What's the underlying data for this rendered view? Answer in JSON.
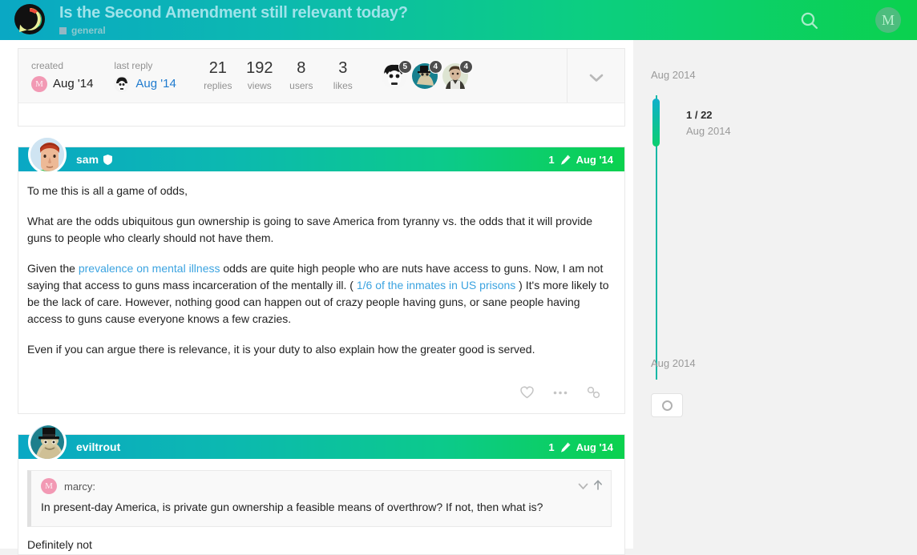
{
  "header": {
    "topic_title": "Is the Second Amendment still relevant today?",
    "category": "general",
    "logo_name": "discourse-logo",
    "search_icon": "search-icon",
    "menu_icon": "hamburger-menu-icon",
    "user_avatar_letter": "M",
    "gradient_start": "#0aa8c4",
    "gradient_end": "#0bd14e",
    "title_color": "#9fe3ea"
  },
  "topic_map": {
    "created_label": "created",
    "created_avatar_letter": "M",
    "created_date": "Aug '14",
    "last_reply_label": "last reply",
    "last_reply_date": "Aug '14",
    "stats": [
      {
        "value": "21",
        "label": "replies"
      },
      {
        "value": "192",
        "label": "views"
      },
      {
        "value": "8",
        "label": "users"
      },
      {
        "value": "3",
        "label": "likes"
      }
    ],
    "participants": [
      {
        "name": "participant-1",
        "count": "5"
      },
      {
        "name": "participant-2",
        "count": "4"
      },
      {
        "name": "participant-3",
        "count": "4"
      }
    ],
    "expand_icon": "chevron-down-icon"
  },
  "posts": [
    {
      "username": "sam",
      "badge_icon": "shield-icon",
      "post_number": "1",
      "edit_icon": "pencil-icon",
      "date": "Aug '14",
      "paragraphs": [
        {
          "parts": [
            {
              "text": "To me this is all a game of odds,"
            }
          ]
        },
        {
          "parts": [
            {
              "text": "What are the odds ubiquitous gun ownership is going to save America from tyranny vs. the odds that it will provide guns to people who clearly should not have them."
            }
          ]
        },
        {
          "parts": [
            {
              "text": "Given the "
            },
            {
              "text": "prevalence on mental illness",
              "link": true
            },
            {
              "text": " odds are quite high people who are nuts have access to guns. Now, I am not saying that access to guns mass incarceration of the mentally ill. ( "
            },
            {
              "text": "1/6 of the inmates in US prisons",
              "link": true
            },
            {
              "text": " ) It's more likely to be the lack of care. However, nothing good can happen out of crazy people having guns, or sane people having access to guns cause everyone knows a few crazies."
            }
          ]
        },
        {
          "parts": [
            {
              "text": "Even if you can argue there is relevance, it is your duty to also explain how the greater good is served."
            }
          ]
        }
      ],
      "actions": [
        {
          "name": "like-button",
          "icon": "heart-icon"
        },
        {
          "name": "show-more-actions-button",
          "icon": "ellipsis-icon"
        },
        {
          "name": "share-button",
          "icon": "link-icon"
        }
      ]
    },
    {
      "username": "eviltrout",
      "post_number": "1",
      "edit_icon": "pencil-icon",
      "date": "Aug '14",
      "quote": {
        "author_avatar_letter": "M",
        "author": "marcy:",
        "text": "In present-day America, is private gun ownership a feasible means of overthrow? If not, then what is?",
        "collapse_icon": "chevron-down-icon",
        "jump_icon": "arrow-up-icon"
      },
      "reply_text": "Definitely not"
    }
  ],
  "timeline": {
    "top_date": "Aug 2014",
    "current_position": "1 / 22",
    "current_date": "Aug 2014",
    "bottom_date": "Aug 2014",
    "track_color": "#17b8a6",
    "notification_button_icon": "circle-icon"
  }
}
